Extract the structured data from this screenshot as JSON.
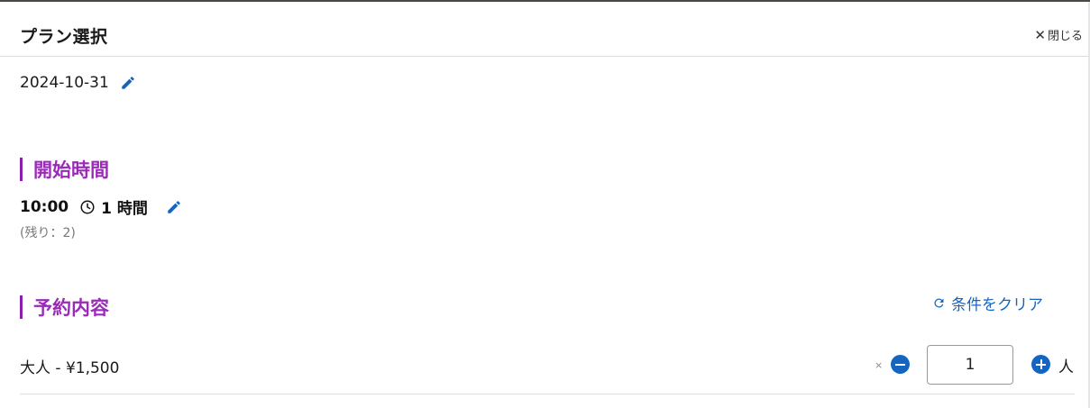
{
  "header": {
    "title": "プラン選択",
    "close_label": "閉じる",
    "close_symbol": "✕"
  },
  "date": {
    "value": "2024-10-31"
  },
  "start_time": {
    "heading": "開始時間",
    "time": "10:00",
    "duration": "1 時間",
    "remaining": "(残り：2)"
  },
  "reservation": {
    "heading": "予約内容",
    "clear_label": "条件をクリア",
    "items": [
      {
        "label": "大人 - ¥1,500",
        "times_symbol": "×",
        "quantity": "1",
        "unit": "人"
      }
    ]
  },
  "icons": {
    "edit": "pencil-icon",
    "clock": "clock-icon",
    "refresh": "refresh-icon",
    "minus": "minus-circle-icon",
    "plus": "plus-circle-icon"
  },
  "colors": {
    "accent_purple": "#9a2ab8",
    "accent_blue": "#1565c0"
  }
}
